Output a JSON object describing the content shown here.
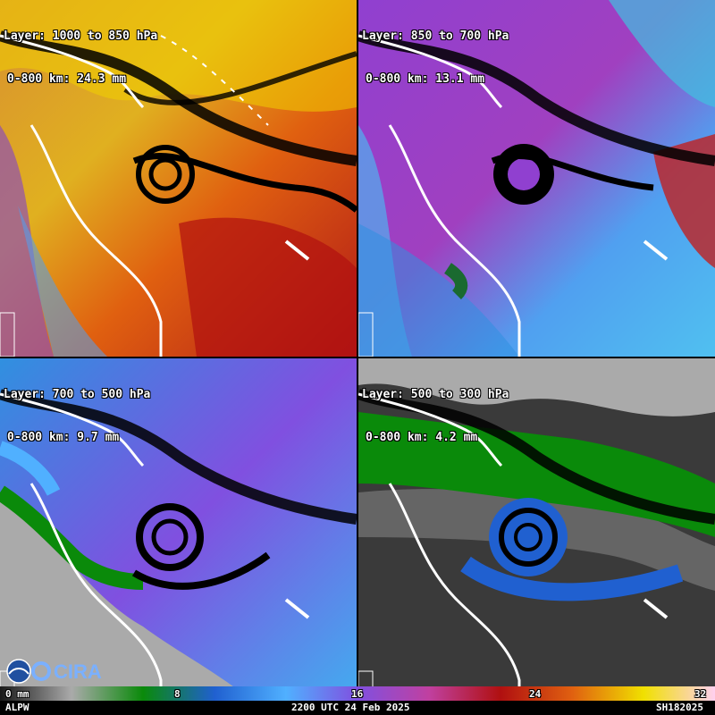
{
  "panels": [
    {
      "id": "p1",
      "layer": "Layer: 1000 to 850 hPa",
      "pw": "0-800 km: 24.3 mm"
    },
    {
      "id": "p2",
      "layer": "Layer: 850 to 700 hPa",
      "pw": "0-800 km: 13.1 mm"
    },
    {
      "id": "p3",
      "layer": "Layer: 700 to 500 hPa",
      "pw": "0-800 km: 9.7 mm"
    },
    {
      "id": "p4",
      "layer": "Layer: 500 to 300 hPa",
      "pw": "0-800 km: 4.2 mm"
    }
  ],
  "colorbar": {
    "labels": [
      "0 mm",
      "8",
      "16",
      "24",
      "32"
    ],
    "colors": [
      "#1a1a1a",
      "#aaaaaa",
      "#0a8a0a",
      "#2060d0",
      "#50b0ff",
      "#8050e0",
      "#c040a0",
      "#b01010",
      "#e06010",
      "#f0e000",
      "#ffd0f0"
    ]
  },
  "footer": {
    "left": "ALPW",
    "center": "2200 UTC 24 Feb 2025",
    "right": "SH182025"
  },
  "logo": {
    "text": "CIRA"
  }
}
